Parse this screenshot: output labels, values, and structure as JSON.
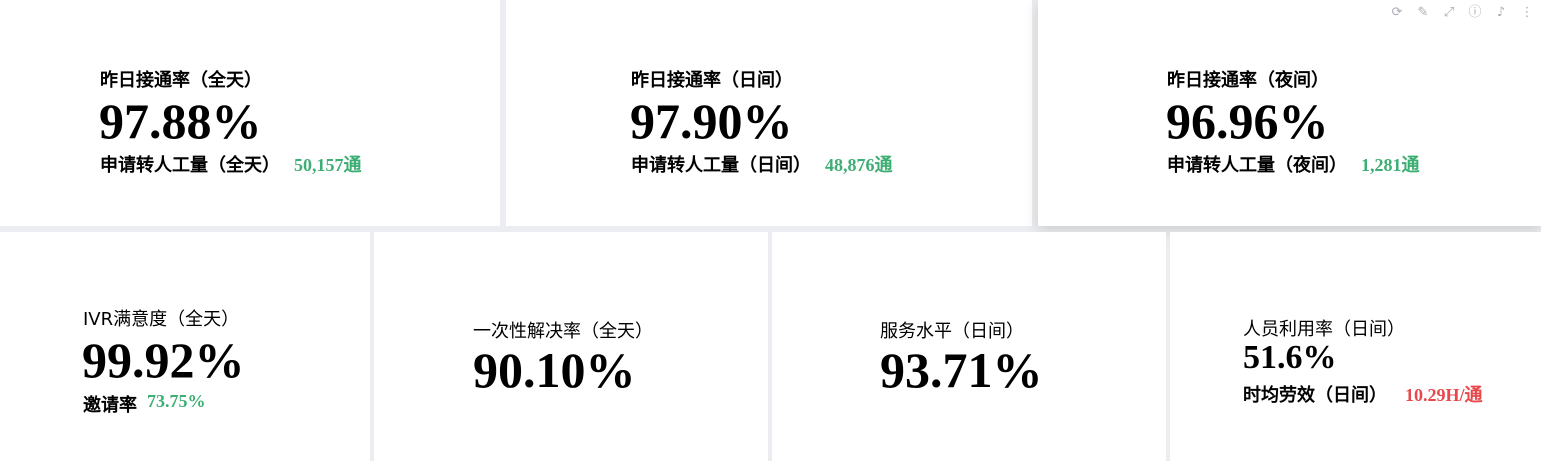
{
  "top": [
    {
      "label": "昨日接通率（全天）",
      "value": "97.88%",
      "sub_label": "申请转人工量（全天）",
      "sub_value": "50,157通"
    },
    {
      "label": "昨日接通率（日间）",
      "value": "97.90%",
      "sub_label": "申请转人工量（日间）",
      "sub_value": "48,876通"
    },
    {
      "label": "昨日接通率（夜间）",
      "value": "96.96%",
      "sub_label": "申请转人工量（夜间）",
      "sub_value": "1,281通"
    }
  ],
  "bottom": [
    {
      "label": "IVR满意度（全天）",
      "value": "99.92%",
      "sub_label": "邀请率",
      "sub_value": "73.75%"
    },
    {
      "label": "一次性解决率（全天）",
      "value": "90.10%"
    },
    {
      "label": "服务水平（日间）",
      "value": "93.71%"
    },
    {
      "label": "人员利用率（日间）",
      "value": "51.6%",
      "sub_label": "时均劳效（日间）",
      "sub_value": "10.29H/通"
    }
  ],
  "toolbar_icons": [
    "refresh-icon",
    "edit-icon",
    "expand-icon",
    "info-icon",
    "bell-icon",
    "more-icon"
  ],
  "colors": {
    "positive": "#3dae74",
    "negative": "#e8474c",
    "background": "#ebedf0",
    "card": "#ffffff"
  }
}
